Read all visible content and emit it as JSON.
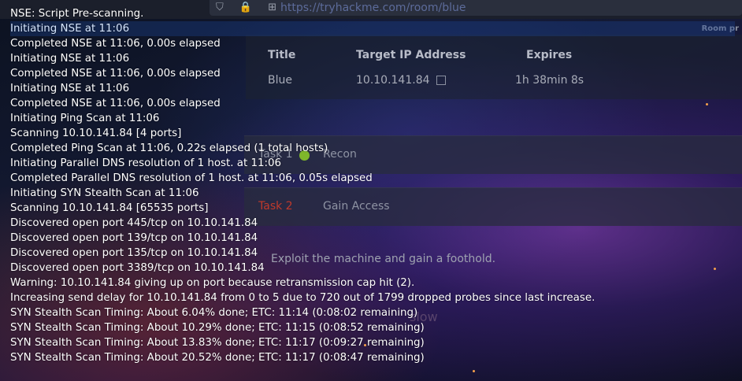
{
  "browser": {
    "url_icons": "⛉ 🔒 ⊞",
    "url": "https://tryhackme.com/room/blue",
    "room_label": "Room pr"
  },
  "room_table": {
    "headers": [
      "Title",
      "Target IP Address",
      "Expires"
    ],
    "row": {
      "title": "Blue",
      "ip": "10.10.141.84",
      "expires": "1h 38min 8s"
    }
  },
  "tasks": [
    {
      "number": "Task 1",
      "title": "Recon",
      "status_color": "#7fb72a",
      "number_color": "#8e93a3"
    },
    {
      "number": "Task 2",
      "title": "Gain Access",
      "status_color": "",
      "number_color": "#c0392b"
    }
  ],
  "task_description": "Exploit the machine and gain a foothold.",
  "faint_word": "slow",
  "terminal_lines": [
    "NSE: Script Pre-scanning.",
    "Initiating NSE at 11:06",
    "Completed NSE at 11:06, 0.00s elapsed",
    "Initiating NSE at 11:06",
    "Completed NSE at 11:06, 0.00s elapsed",
    "Initiating NSE at 11:06",
    "Completed NSE at 11:06, 0.00s elapsed",
    "Initiating Ping Scan at 11:06",
    "Scanning 10.10.141.84 [4 ports]",
    "Completed Ping Scan at 11:06, 0.22s elapsed (1 total hosts)",
    "Initiating Parallel DNS resolution of 1 host. at 11:06",
    "Completed Parallel DNS resolution of 1 host. at 11:06, 0.05s elapsed",
    "Initiating SYN Stealth Scan at 11:06",
    "Scanning 10.10.141.84 [65535 ports]",
    "Discovered open port 445/tcp on 10.10.141.84",
    "Discovered open port 139/tcp on 10.10.141.84",
    "Discovered open port 135/tcp on 10.10.141.84",
    "Discovered open port 3389/tcp on 10.10.141.84",
    "Warning: 10.10.141.84 giving up on port because retransmission cap hit (2).",
    "Increasing send delay for 10.10.141.84 from 0 to 5 due to 720 out of 1799 dropped probes since last increase.",
    "SYN Stealth Scan Timing: About 6.04% done; ETC: 11:14 (0:08:02 remaining)",
    "SYN Stealth Scan Timing: About 10.29% done; ETC: 11:15 (0:08:52 remaining)",
    "SYN Stealth Scan Timing: About 13.83% done; ETC: 11:17 (0:09:27 remaining)",
    "SYN Stealth Scan Timing: About 20.52% done; ETC: 11:17 (0:08:47 remaining)"
  ]
}
